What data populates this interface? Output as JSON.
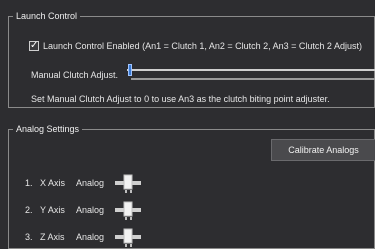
{
  "launch_control": {
    "title": "Launch Control",
    "enabled_checked": true,
    "enabled_label": "Launch Control Enabled (An1 = Clutch 1, An2 = Clutch 2, An3 = Clutch 2 Adjust)",
    "manual_clutch_label": "Manual Clutch Adjust.",
    "manual_clutch_value": 0,
    "hint": "Set Manual Clutch Adjust to 0 to use An3 as the clutch biting point adjuster."
  },
  "analog_settings": {
    "title": "Analog Settings",
    "calibrate_label": "Calibrate Analogs",
    "axes": [
      {
        "num": "1.",
        "name": "X Axis",
        "type": "Analog"
      },
      {
        "num": "2.",
        "name": "Y Axis",
        "type": "Analog"
      },
      {
        "num": "3.",
        "name": "Z Axis",
        "type": "Analog"
      }
    ]
  },
  "colors": {
    "background": "#2d2d30",
    "accent": "#3a7bd5",
    "text": "#e6e6e6"
  }
}
